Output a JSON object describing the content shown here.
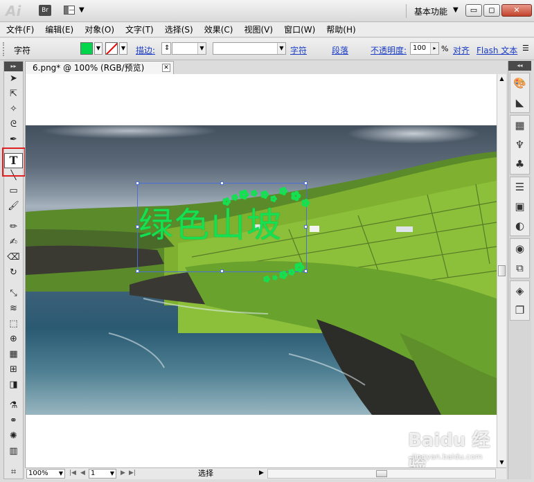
{
  "app": {
    "logo": "Ai",
    "bridge_label": "Br",
    "workspace": "基本功能",
    "window_buttons": {
      "minimize": "▭",
      "restore": "◻",
      "close": "✕"
    }
  },
  "menu": [
    "文件(F)",
    "编辑(E)",
    "对象(O)",
    "文字(T)",
    "选择(S)",
    "效果(C)",
    "视图(V)",
    "窗口(W)",
    "帮助(H)"
  ],
  "control_bar": {
    "label": "字符",
    "fill_color": "#00d64b",
    "stroke_label": "描边:",
    "stroke_value": "",
    "brush_value": "",
    "character_link": "字符",
    "paragraph_link": "段落",
    "opacity_label": "不透明度:",
    "opacity_value": "100",
    "opacity_unit": "%",
    "align_link": "对齐",
    "flash_text_link": "Flash 文本"
  },
  "document": {
    "tab_title": "6.png* @ 100% (RGB/预览)",
    "text_object": "绿色山坡",
    "text_color": "#14e052",
    "selection_color": "#4b6fd8"
  },
  "tools": [
    {
      "name": "selection-tool",
      "glyph": "➤"
    },
    {
      "name": "direct-selection-tool",
      "glyph": "⇱"
    },
    {
      "name": "magic-wand-tool",
      "glyph": "✧"
    },
    {
      "name": "lasso-tool",
      "glyph": "ᘓ"
    },
    {
      "name": "pen-tool",
      "glyph": "✒"
    },
    {
      "name": "type-tool",
      "glyph": "T"
    },
    {
      "name": "line-tool",
      "glyph": "╲"
    },
    {
      "name": "rectangle-tool",
      "glyph": "▭"
    },
    {
      "name": "paintbrush-tool",
      "glyph": "🖌"
    },
    {
      "name": "pencil-tool",
      "glyph": "✏"
    },
    {
      "name": "blob-brush-tool",
      "glyph": "✍"
    },
    {
      "name": "eraser-tool",
      "glyph": "⌫"
    },
    {
      "name": "rotate-tool",
      "glyph": "↻"
    },
    {
      "name": "scale-tool",
      "glyph": "⤡"
    },
    {
      "name": "warp-tool",
      "glyph": "≋"
    },
    {
      "name": "free-transform-tool",
      "glyph": "⬚"
    },
    {
      "name": "shape-builder-tool",
      "glyph": "⊕"
    },
    {
      "name": "perspective-grid-tool",
      "glyph": "▦"
    },
    {
      "name": "mesh-tool",
      "glyph": "⊞"
    },
    {
      "name": "gradient-tool",
      "glyph": "◨"
    },
    {
      "name": "eyedropper-tool",
      "glyph": "⚗"
    },
    {
      "name": "blend-tool",
      "glyph": "⚭"
    },
    {
      "name": "symbol-sprayer-tool",
      "glyph": "✺"
    },
    {
      "name": "column-graph-tool",
      "glyph": "▥"
    },
    {
      "name": "artboard-tool",
      "glyph": "⌗"
    },
    {
      "name": "slice-tool",
      "glyph": "✂"
    }
  ],
  "status_bar": {
    "zoom": "100%",
    "artboard": "1",
    "status": "选择"
  },
  "right_panels": [
    [
      "color-guide-icon",
      "stroke-gradient-icon"
    ],
    [
      "swatches-icon",
      "brushes-icon",
      "symbols-icon"
    ],
    [
      "stroke-icon",
      "gradient-icon",
      "transparency-icon"
    ],
    [
      "appearance-icon",
      "graphic-styles-icon"
    ],
    [
      "layers-icon",
      "artboards-icon"
    ]
  ],
  "right_panel_glyphs": {
    "color-guide-icon": "🎨",
    "stroke-gradient-icon": "◣",
    "swatches-icon": "▦",
    "brushes-icon": "♆",
    "symbols-icon": "♣",
    "stroke-icon": "☰",
    "gradient-icon": "▣",
    "transparency-icon": "◐",
    "appearance-icon": "◉",
    "graphic-styles-icon": "⧉",
    "layers-icon": "◈",
    "artboards-icon": "❐"
  },
  "watermark": {
    "brand": "Baidu 经验",
    "sub": "jingyan.baidu.com"
  }
}
